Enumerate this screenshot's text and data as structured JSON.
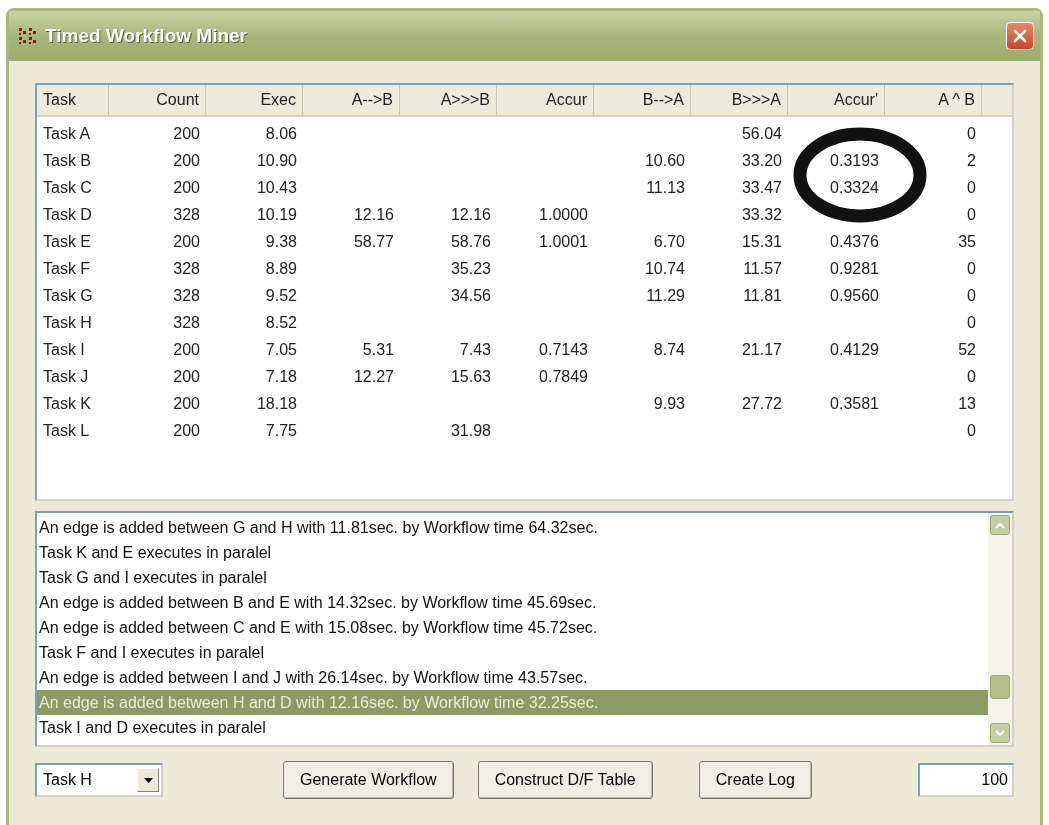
{
  "window": {
    "title": "Timed Workflow Miner"
  },
  "table": {
    "columns": [
      "Task",
      "Count",
      "Exec",
      "A-->B",
      "A>>>B",
      "Accur",
      "B-->A",
      "B>>>A",
      "Accur'",
      "A ^ B"
    ],
    "rows": [
      [
        "Task A",
        "200",
        "8.06",
        null,
        null,
        null,
        null,
        "56.04",
        null,
        "0"
      ],
      [
        "Task B",
        "200",
        "10.90",
        null,
        null,
        null,
        "10.60",
        "33.20",
        "0.3193",
        "2"
      ],
      [
        "Task C",
        "200",
        "10.43",
        null,
        null,
        null,
        "11.13",
        "33.47",
        "0.3324",
        "0"
      ],
      [
        "Task D",
        "328",
        "10.19",
        "12.16",
        "12.16",
        "1.0000",
        null,
        "33.32",
        null,
        "0"
      ],
      [
        "Task E",
        "200",
        "9.38",
        "58.77",
        "58.76",
        "1.0001",
        "6.70",
        "15.31",
        "0.4376",
        "35"
      ],
      [
        "Task F",
        "328",
        "8.89",
        null,
        "35.23",
        null,
        "10.74",
        "11.57",
        "0.9281",
        "0"
      ],
      [
        "Task G",
        "328",
        "9.52",
        null,
        "34.56",
        null,
        "11.29",
        "11.81",
        "0.9560",
        "0"
      ],
      [
        "Task H",
        "328",
        "8.52",
        null,
        null,
        null,
        null,
        null,
        null,
        "0"
      ],
      [
        "Task I",
        "200",
        "7.05",
        "5.31",
        "7.43",
        "0.7143",
        "8.74",
        "21.17",
        "0.4129",
        "52"
      ],
      [
        "Task J",
        "200",
        "7.18",
        "12.27",
        "15.63",
        "0.7849",
        null,
        null,
        null,
        "0"
      ],
      [
        "Task K",
        "200",
        "18.18",
        null,
        null,
        null,
        "9.93",
        "27.72",
        "0.3581",
        "13"
      ],
      [
        "Task L",
        "200",
        "7.75",
        null,
        "31.98",
        null,
        null,
        null,
        null,
        "0"
      ]
    ]
  },
  "log": [
    {
      "text": "An edge is added between G and H with 11.81sec. by Workflow time 64.32sec.",
      "selected": false
    },
    {
      "text": "Task K and E executes in paralel",
      "selected": false
    },
    {
      "text": "Task G and I executes in paralel",
      "selected": false
    },
    {
      "text": "An edge is added between B and E with 14.32sec. by Workflow time 45.69sec.",
      "selected": false
    },
    {
      "text": "An edge is added between C and E with 15.08sec. by Workflow time 45.72sec.",
      "selected": false
    },
    {
      "text": "Task F and I executes in paralel",
      "selected": false
    },
    {
      "text": "An edge is added between I and J with 26.14sec. by Workflow time 43.57sec.",
      "selected": false
    },
    {
      "text": "An edge is added between H and D with 12.16sec. by Workflow time 32.25sec.",
      "selected": true
    },
    {
      "text": "Task I and D executes in paralel",
      "selected": false
    }
  ],
  "task_select": {
    "value": "Task H"
  },
  "buttons": [
    "Generate Workflow",
    "Construct D/F Table",
    "Create Log"
  ],
  "count_field": {
    "value": "100"
  }
}
